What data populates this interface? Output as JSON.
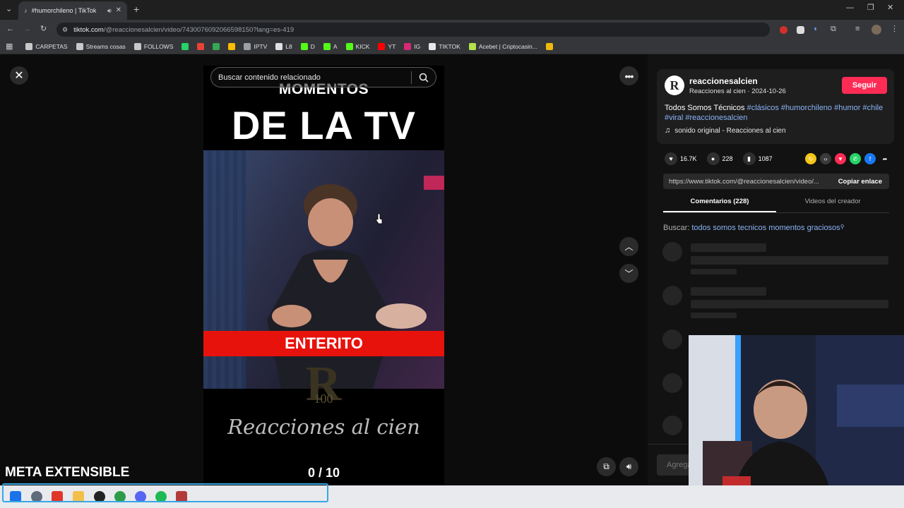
{
  "browser": {
    "tab_title": "#humorchileno | TikTok",
    "address_domain": "tiktok.com",
    "address_path": "/@reaccionesalcien/video/7430076092066598150?lang=es-419",
    "bookmarks": [
      {
        "label": "CARPETAS",
        "color": "#c8c8c8"
      },
      {
        "label": "Streams cosas",
        "color": "#c8c8c8"
      },
      {
        "label": "FOLLOWS",
        "color": "#c8c8c8"
      },
      {
        "label": "",
        "color": "#25d366"
      },
      {
        "label": "",
        "color": "#ea4335"
      },
      {
        "label": "",
        "color": "#34a853"
      },
      {
        "label": "",
        "color": "#fbbc04"
      },
      {
        "label": "IPTV",
        "color": "#9aa0a6"
      },
      {
        "label": "L8",
        "color": "#e0e0e0"
      },
      {
        "label": "D",
        "color": "#53fc18"
      },
      {
        "label": "A",
        "color": "#53fc18"
      },
      {
        "label": "KICK",
        "color": "#53fc18"
      },
      {
        "label": "YT",
        "color": "#ff0000"
      },
      {
        "label": "IG",
        "color": "#d62976"
      },
      {
        "label": "TIKTOK",
        "color": "#e8e8e8"
      },
      {
        "label": "Acebet | Criptocasin...",
        "color": "#b4e04a"
      },
      {
        "label": "",
        "color": "#f0b90b"
      }
    ]
  },
  "video": {
    "search_placeholder": "Buscar contenido relacionado",
    "title_top": "MOMENTOS",
    "title_main": "DE LA TV",
    "banner": "ENTERITO",
    "logo_letter": "R",
    "logo_number": "100",
    "brand_text": "Reacciones al cien",
    "counter": "0  / 10"
  },
  "overlay": {
    "meta_text": "META EXTENSIBLE"
  },
  "post": {
    "username": "reaccionesalcien",
    "display_name": "Reacciones al cien",
    "date": "2024-10-26",
    "follow_label": "Seguir",
    "desc_text": "Todos Somos Técnicos ",
    "hashtags": [
      "#clásicos",
      "#humorchileno",
      "#humor",
      "#chile",
      "#viral",
      "#reaccionesalcien"
    ],
    "music": "sonido original - Reacciones al cien",
    "likes": "16.7K",
    "comments": "228",
    "saves": "1087",
    "link": "https://www.tiktok.com/@reaccionesalcien/video/...",
    "copy_label": "Copiar enlace",
    "tab_comments": "Comentarios (228)",
    "tab_videos": "Videos del creador",
    "search_prefix": "Buscar:",
    "search_query": "todos somos tecnicos momentos graciosos",
    "comment_placeholder": "Agrega"
  }
}
